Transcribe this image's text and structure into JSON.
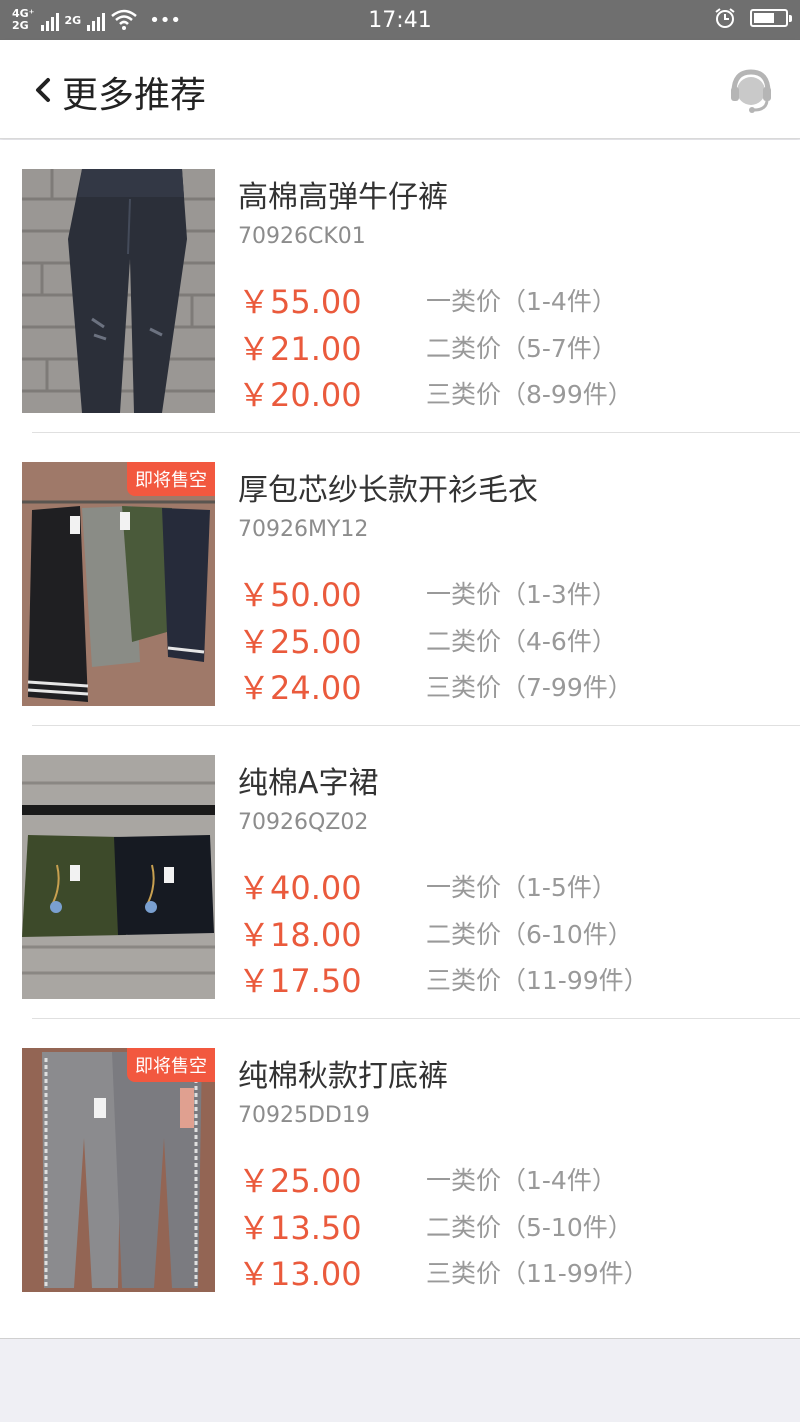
{
  "status_bar": {
    "network_1": "4G⁺",
    "network_2": "2G",
    "network_3": "2G",
    "more": "•••",
    "time": "17:41",
    "battery_level": 0.65
  },
  "header": {
    "back_icon": "chevron-left-icon",
    "title": "更多推荐",
    "service_icon": "customer-service-headset-icon"
  },
  "products": [
    {
      "name": "高棉高弹牛仔裤",
      "code": "70926CK01",
      "badge": "",
      "image": "black ripped jeans hanging on brick wall",
      "prices": [
        {
          "price": "￥55.00",
          "tier": "一类价（1-4件）"
        },
        {
          "price": "￥21.00",
          "tier": "二类价（5-7件）"
        },
        {
          "price": "￥20.00",
          "tier": "三类价（8-99件）"
        }
      ]
    },
    {
      "name": "厚包芯纱长款开衫毛衣",
      "code": "70926MY12",
      "badge": "即将售空",
      "image": "long knit cardigans on hangers",
      "prices": [
        {
          "price": "￥50.00",
          "tier": "一类价（1-3件）"
        },
        {
          "price": "￥25.00",
          "tier": "二类价（4-6件）"
        },
        {
          "price": "￥24.00",
          "tier": "三类价（7-99件）"
        }
      ]
    },
    {
      "name": "纯棉A字裙",
      "code": "70926QZ02",
      "badge": "",
      "image": "green and black A-line skirts on rail",
      "prices": [
        {
          "price": "￥40.00",
          "tier": "一类价（1-5件）"
        },
        {
          "price": "￥18.00",
          "tier": "二类价（6-10件）"
        },
        {
          "price": "￥17.50",
          "tier": "三类价（11-99件）"
        }
      ]
    },
    {
      "name": "纯棉秋款打底裤",
      "code": "70925DD19",
      "badge": "即将售空",
      "image": "grey leggings with lettered side stripe",
      "prices": [
        {
          "price": "￥25.00",
          "tier": "一类价（1-4件）"
        },
        {
          "price": "￥13.50",
          "tier": "二类价（5-10件）"
        },
        {
          "price": "￥13.00",
          "tier": "三类价（11-99件）"
        }
      ]
    }
  ],
  "colors": {
    "price": "#ea5a3c",
    "badge": "#f2583f",
    "status_bar": "#6f6f6f"
  }
}
